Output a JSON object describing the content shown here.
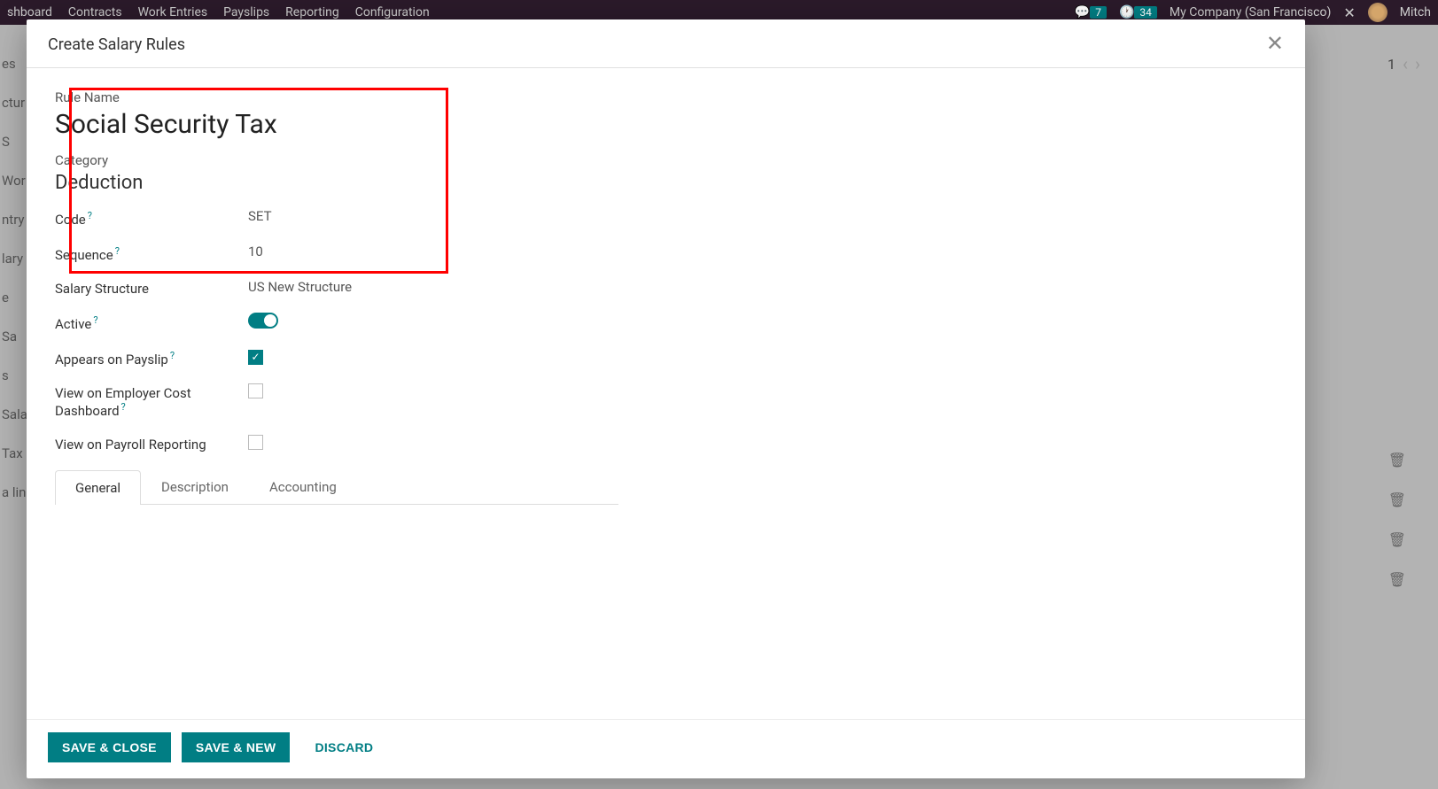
{
  "topbar": {
    "nav": [
      "shboard",
      "Contracts",
      "Work Entries",
      "Payslips",
      "Reporting",
      "Configuration"
    ],
    "msg_badge": "7",
    "activity_badge": "34",
    "company": "My Company (San Francisco)",
    "user": "Mitch"
  },
  "pager": {
    "value": "1"
  },
  "bg_rows": [
    "es",
    "ctur",
    "S",
    "Wor",
    "ntry",
    "lary",
    "e",
    "Sa",
    "s",
    "Sala",
    "Tax",
    "a lin"
  ],
  "modal": {
    "title": "Create Salary Rules",
    "fields": {
      "rule_name_label": "Rule Name",
      "rule_name": "Social Security Tax",
      "category_label": "Category",
      "category": "Deduction",
      "code_label": "Code",
      "code": "SET",
      "sequence_label": "Sequence",
      "sequence": "10",
      "salary_structure_label": "Salary Structure",
      "salary_structure": "US New Structure",
      "active_label": "Active",
      "appears_label": "Appears on Payslip",
      "employer_cost_label": "View on Employer Cost Dashboard",
      "payroll_report_label": "View on Payroll Reporting"
    },
    "tabs": [
      "General",
      "Description",
      "Accounting"
    ],
    "buttons": {
      "save_close": "SAVE & CLOSE",
      "save_new": "SAVE & NEW",
      "discard": "DISCARD"
    }
  }
}
